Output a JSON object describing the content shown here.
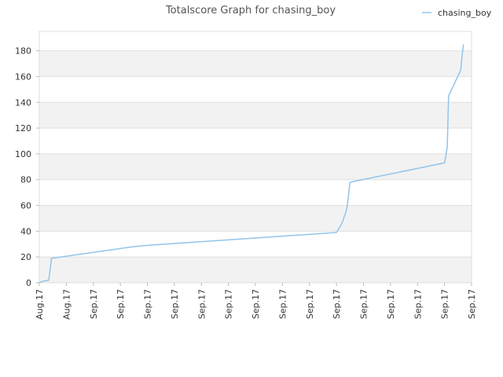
{
  "chart_data": {
    "type": "line",
    "title": "Totalscore Graph for chasing_boy",
    "xlabel": "",
    "ylabel": "",
    "legend_position": "top-right",
    "grid": true,
    "ylim": [
      0,
      195
    ],
    "y_ticks": [
      0,
      20,
      40,
      60,
      80,
      100,
      120,
      140,
      160,
      180
    ],
    "x_tick_labels": [
      "Aug.17",
      "Aug.17",
      "Sep.17",
      "Sep.17",
      "Sep.17",
      "Sep.17",
      "Sep.17",
      "Sep.17",
      "Sep.17",
      "Sep.17",
      "Sep.17",
      "Sep.17",
      "Sep.17",
      "Sep.17",
      "Sep.17",
      "Sep.17",
      "Sep.17"
    ],
    "xlim": [
      0,
      16
    ],
    "series": [
      {
        "name": "chasing_boy",
        "color": "#92c5ea",
        "x": [
          0.0,
          0.1,
          0.35,
          0.4,
          0.45,
          3.5,
          4.0,
          11.0,
          11.2,
          11.35,
          11.4,
          11.5,
          15.0,
          15.1,
          15.15,
          15.6,
          15.65,
          15.7
        ],
        "y": [
          0,
          1,
          2,
          10,
          19,
          28,
          29,
          39,
          46,
          55,
          60,
          78,
          93,
          105,
          145,
          165,
          176,
          185
        ]
      }
    ]
  }
}
